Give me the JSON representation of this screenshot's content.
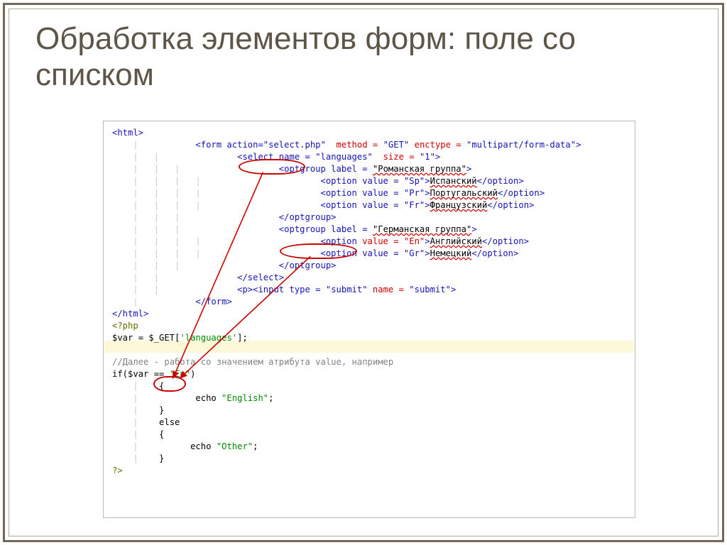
{
  "title": "Обработка элементов форм: поле со списком",
  "code": {
    "l1": "<html>",
    "l2a": "        <form action=",
    "l2b": "\"select.php\"",
    "l2c": "  method = ",
    "l2d": "\"GET\"",
    "l2e": " enctype = ",
    "l2f": "\"multipart/form-data\"",
    "l2g": ">",
    "l3a": "            <select name = ",
    "l3b": "\"languages\"",
    "l3c": "  size = ",
    "l3d": "\"1\"",
    "l3e": ">",
    "l4a": "                <optgroup label = ",
    "l4b": "\"Романская группа\"",
    "l4c": ">",
    "l5a": "                    <option value = ",
    "l5b": "\"Sp\"",
    "l5c": ">",
    "l5t": "Испанский",
    "l5d": "</option>",
    "l6a": "                    <option value = ",
    "l6b": "\"Pr\"",
    "l6c": ">",
    "l6t": "Португальский",
    "l6d": "</option>",
    "l7a": "                    <option value = ",
    "l7b": "\"Fr\"",
    "l7c": ">",
    "l7t": "Французский",
    "l7d": "</option>",
    "l8": "                </optgroup>",
    "l9a": "                <optgroup label = ",
    "l9b": "\"Германская группа\"",
    "l9c": ">",
    "l10a": "                    <option ",
    "l10b": "value = \"En\"",
    "l10c": ">",
    "l10t": "Английский",
    "l10d": "</option>",
    "l11a": "                    <option value = ",
    "l11b": "\"Gr\"",
    "l11c": ">",
    "l11t": "Немецкий",
    "l11d": "</option>",
    "l12": "                </optgroup>",
    "l13": "            </select>",
    "l14a": "            <p><input type = ",
    "l14b": "\"submit\"",
    "l14c": " name = ",
    "l14d": "\"submit\"",
    "l14e": ">",
    "l15": "        </form>",
    "l16": "</html>",
    "l17": "<?php",
    "l18a": "$var",
    "l18b": " = ",
    "l18c": "$_GET",
    "l18d": "[",
    "l18e": "'languages'",
    "l18f": "];",
    "l19": " ",
    "l20": "//Далее - работа со значением атрибута value, например",
    "l21a": "if(",
    "l21b": "$var",
    "l21c": " == ",
    "l21d": "\"En\"",
    "l21e": ")",
    "l22": "    {",
    "l23a": "        echo ",
    "l23b": "\"English\"",
    "l23c": ";",
    "l24": "    }",
    "l25": "    else",
    "l26": "    {",
    "l27a": "       echo ",
    "l27b": "\"Other\"",
    "l27c": ";",
    "l28": "    }",
    "l29": "?>"
  }
}
